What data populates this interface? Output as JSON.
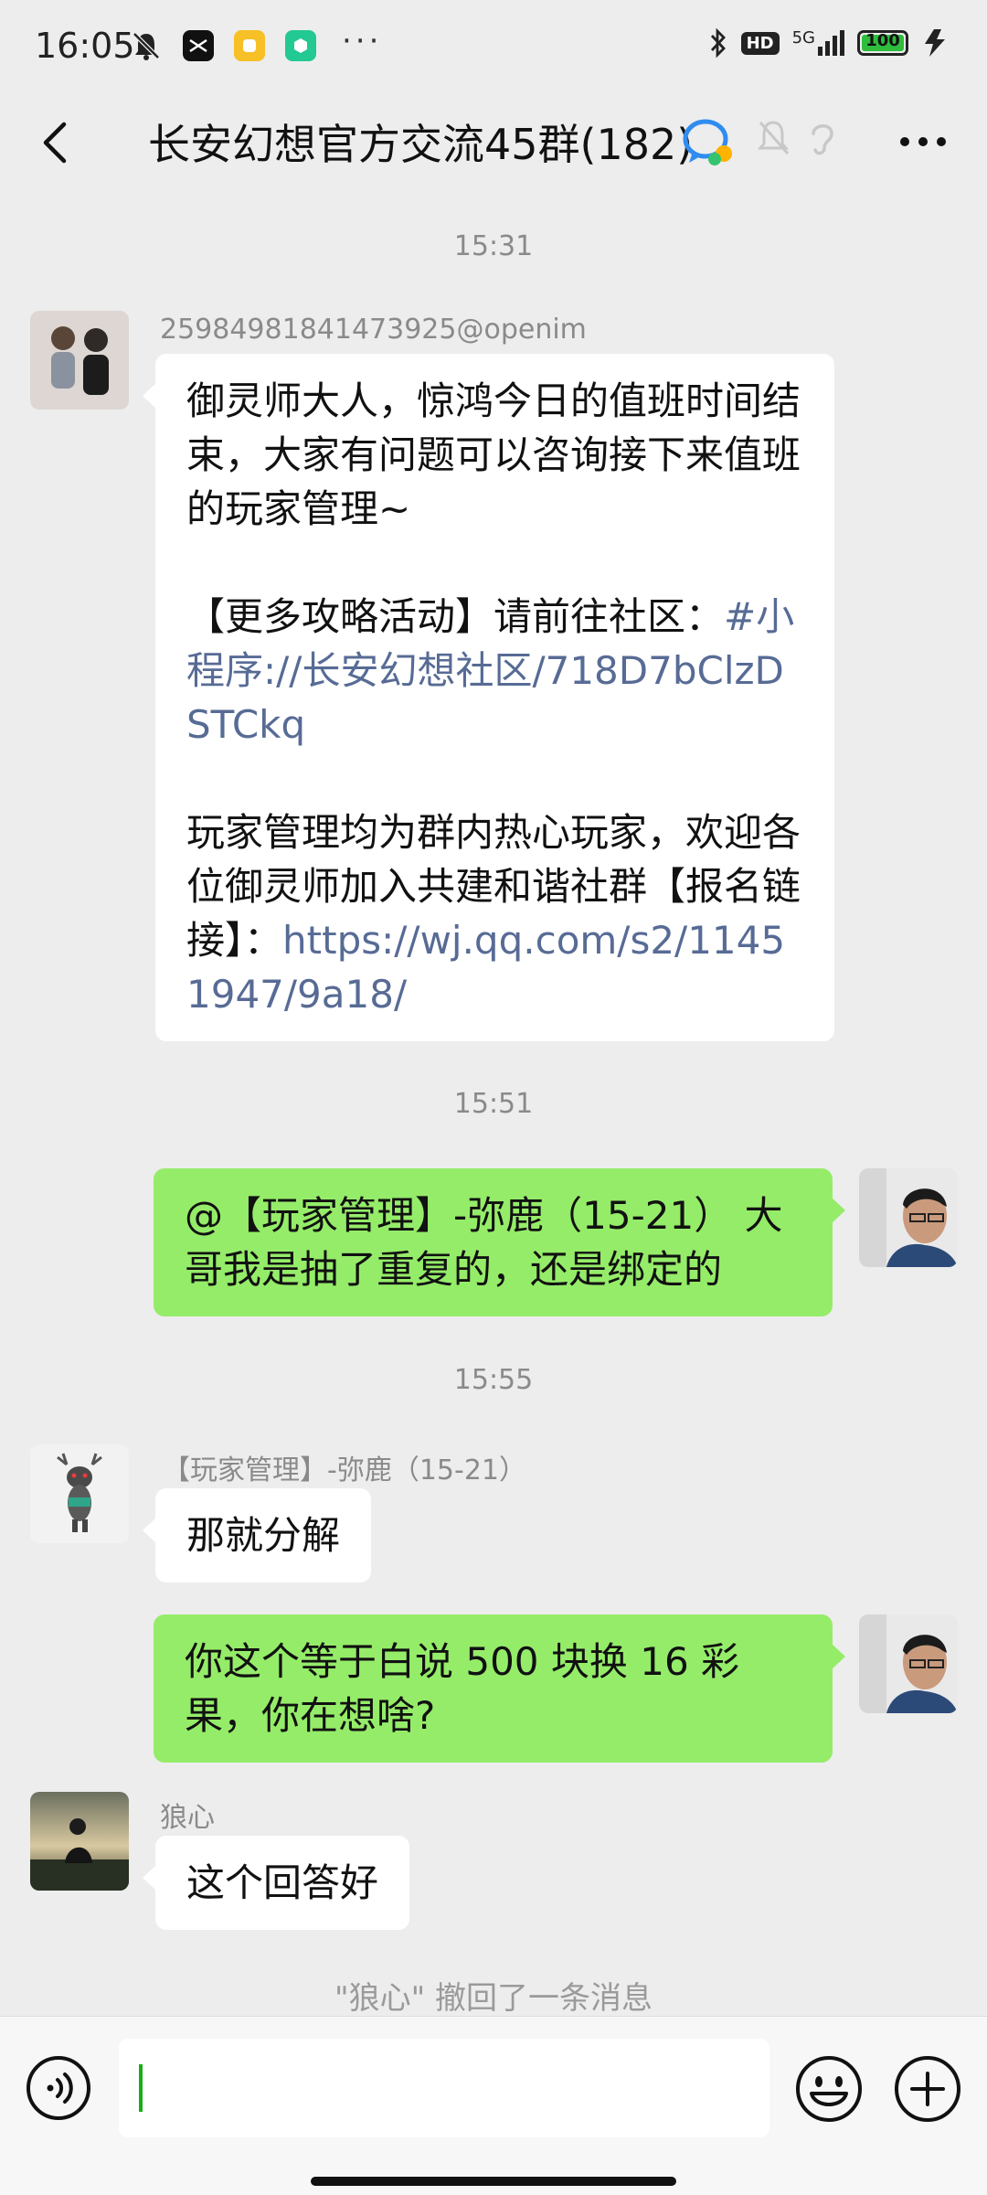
{
  "status_bar": {
    "time": "16:05",
    "network_label": "5G",
    "hd_label": "HD",
    "battery_percent": "100",
    "battery_level": 1.0,
    "icons": [
      "mute-bell-icon",
      "capcut-icon",
      "yellow-app-icon",
      "green-app-icon",
      "more-dots-icon",
      "bluetooth-icon",
      "hd-icon",
      "signal-icon",
      "battery-icon",
      "charging-icon"
    ]
  },
  "header": {
    "title": "长安幻想官方交流45群(182)",
    "icons": [
      "back-arrow-icon",
      "group-chat-icon",
      "mute-icon",
      "ear-icon",
      "more-icon"
    ]
  },
  "messages": [
    {
      "type": "time",
      "text": "15:31"
    },
    {
      "type": "msg",
      "side": "left",
      "sender": "25984981841473925@openim",
      "segments": [
        {
          "text": "御灵师大人，惊鸿今日的值班时间结束，大家有问题可以咨询接下来值班的玩家管理~\n\n【更多攻略活动】请前往社区：",
          "link": false
        },
        {
          "text": "#小程序://长安幻想社区/718D7bClzDSTCkq",
          "link": true
        },
        {
          "text": "\n\n玩家管理均为群内热心玩家，欢迎各位御灵师加入共建和谐社群【报名链接】：",
          "link": false
        },
        {
          "text": "https://wj.qq.com/s2/11451947/9a18/",
          "link": true
        }
      ]
    },
    {
      "type": "time",
      "text": "15:51"
    },
    {
      "type": "msg",
      "side": "right",
      "text": "@【玩家管理】-弥鹿（15-21） 大哥我是抽了重复的，还是绑定的"
    },
    {
      "type": "time",
      "text": "15:55"
    },
    {
      "type": "msg",
      "side": "left",
      "sender": "【玩家管理】-弥鹿（15-21）",
      "text": "那就分解"
    },
    {
      "type": "msg",
      "side": "right",
      "text": "你这个等于白说 500 块换 16 彩果，你在想啥?"
    },
    {
      "type": "msg",
      "side": "left",
      "sender": "狼心",
      "text": "这个回答好"
    }
  ],
  "recall_notice": "\"狼心\" 撤回了一条消息",
  "input": {
    "value": "",
    "icons": [
      "voice-icon",
      "emoji-icon",
      "plus-icon"
    ]
  },
  "colors": {
    "background": "#ededed",
    "my_bubble": "#95ec69",
    "other_bubble": "#ffffff",
    "link": "#576b95",
    "battery": "#2ebd3c"
  }
}
